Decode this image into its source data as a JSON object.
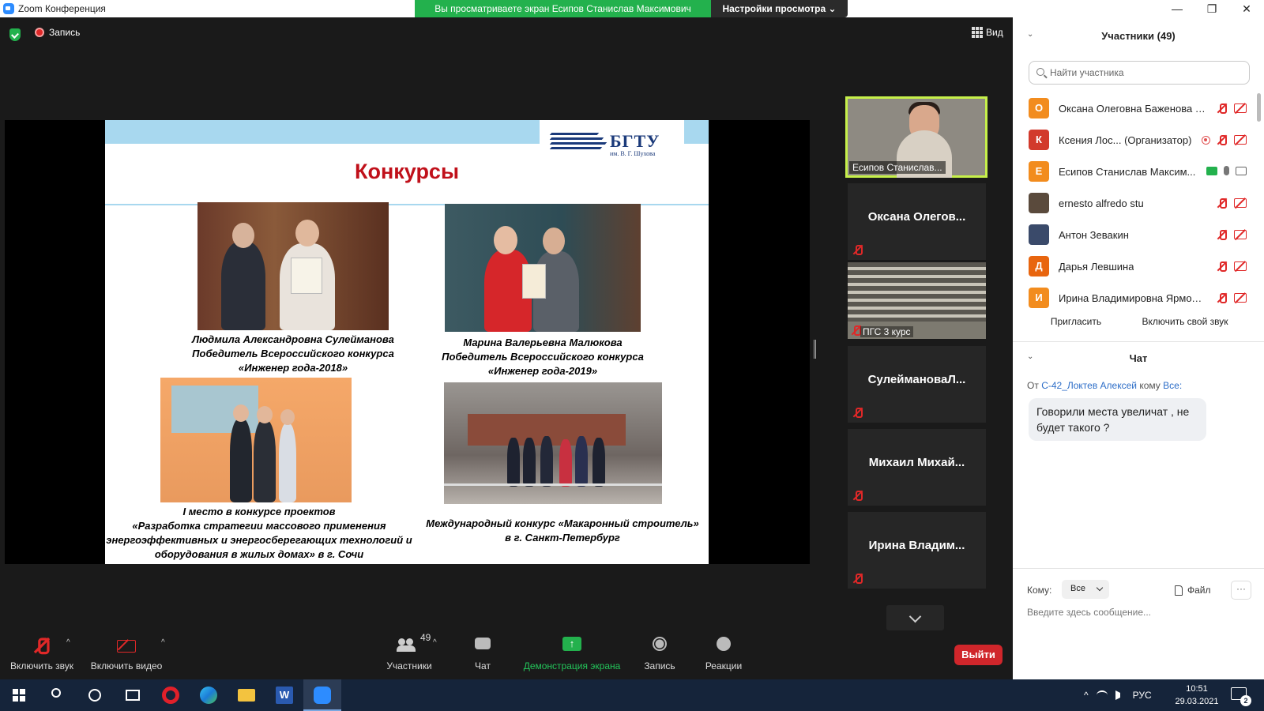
{
  "titlebar": {
    "title": "Zoom Конференция",
    "share_banner": "Вы просматриваете экран Есипов Станислав Максимович",
    "view_settings": "Настройки просмотра ⌄",
    "minimize": "—",
    "maximize": "❐",
    "close": "✕"
  },
  "meeting": {
    "recording_label": "Запись",
    "view_label": "Вид"
  },
  "slide": {
    "logo_name": "БГТУ",
    "logo_sub": "им. В. Г. Шухова",
    "heading": "Конкурсы",
    "captions": [
      [
        "Людмила Александровна Сулейманова",
        "Победитель Всероссийского конкурса",
        "«Инженер года-2018»"
      ],
      [
        "Марина Валерьевна Малюкова",
        "Победитель Всероссийского конкурса",
        "«Инженер года-2019»"
      ],
      [
        "I место в конкурсе проектов",
        "«Разработка стратегии массового применения",
        "энергоэффективных и энергосберегающих технологий и",
        "оборудования в жилых домах» в г. Сочи"
      ],
      [
        "Международный конкурс «Макаронный строитель»",
        "в  г. Санкт-Петербург"
      ]
    ]
  },
  "strip": {
    "video_label": "Есипов Станислав...",
    "hall_label": "ПГС 3 курс",
    "tiles": [
      "Оксана  Олегов...",
      "СулеймановаЛ...",
      "Михаил  Михай...",
      "Ирина  Владим..."
    ]
  },
  "toolbar": {
    "unmute": "Включить звук",
    "start_video": "Включить видео",
    "participants": "Участники",
    "participants_count": "49",
    "chat": "Чат",
    "share": "Демонстрация экрана",
    "record": "Запись",
    "reactions": "Реакции",
    "leave": "Выйти"
  },
  "panel": {
    "participants_title": "Участники (49)",
    "search_placeholder": "Найти участника",
    "participants": [
      {
        "initial": "О",
        "name": "Оксана Олеговна Баженова (Я)",
        "color": "#f28c1e"
      },
      {
        "initial": "К",
        "name": "Ксения Лос...  (Организатор)",
        "color": "#d23a2c"
      },
      {
        "initial": "Е",
        "name": "Есипов Станислав Максим...",
        "color": "#f28c1e"
      },
      {
        "initial": "",
        "name": "ernesto alfredo stu",
        "color": "#5a4a3c"
      },
      {
        "initial": "",
        "name": "Антон Зевакин",
        "color": "#3a4a6a"
      },
      {
        "initial": "Д",
        "name": "Дарья Левшина",
        "color": "#e8650f"
      },
      {
        "initial": "И",
        "name": "Ирина Владимировна Ярмоле...",
        "color": "#f28c1e"
      }
    ],
    "invite": "Пригласить",
    "unmute_self": "Включить свой звук",
    "chat_title": "Чат",
    "chat_from": "От",
    "chat_sender": "С-42_Локтев Алексей",
    "chat_to": "кому",
    "chat_recipient": "Все:",
    "chat_message": "Говорили места увеличат , не будет такого ?",
    "to_label": "Кому:",
    "to_value": "Все",
    "file": "Файл",
    "more": "···",
    "input_placeholder": "Введите здесь сообщение..."
  },
  "taskbar": {
    "language": "РУС",
    "time": "10:51",
    "date": "29.03.2021",
    "notifications": "2"
  }
}
